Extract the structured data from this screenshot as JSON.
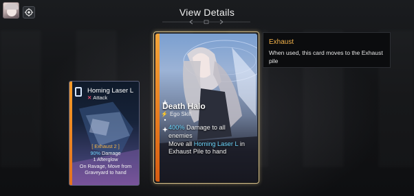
{
  "header": {
    "title": "View Details"
  },
  "small_card": {
    "name": "Homing Laser L",
    "type": "Attack",
    "keyword": "[ Exhaust 2 ]",
    "line1_value": "90%",
    "line1_suffix": " Damage",
    "line2": "1 Afterglow",
    "line3": "On Ravage, Move from",
    "line4": "Graveyard to hand"
  },
  "big_card": {
    "name": "Death Halo",
    "type": "Ego Skill",
    "line1_value": "400%",
    "line1_suffix": " Damage to all",
    "line2": "enemies",
    "line3_prefix": "Move all ",
    "line3_highlight": "Homing Laser L",
    "line3_suffix": " in",
    "line4": "Exhaust Pile to hand"
  },
  "tooltip": {
    "title": "Exhaust",
    "text": "When used, this card moves to the Exhaust pile"
  },
  "colors": {
    "keyword_orange": "#f3b24a",
    "highlight_cyan": "#6fd8ff",
    "attack_red": "#e04a6a",
    "card_stripe_orange": "#f39b2a",
    "card_frame_gold": "#d6c08a"
  },
  "icons": {
    "settings": "settings-icon",
    "attack": "attack-x-icon",
    "ego": "ego-lightning-icon"
  }
}
